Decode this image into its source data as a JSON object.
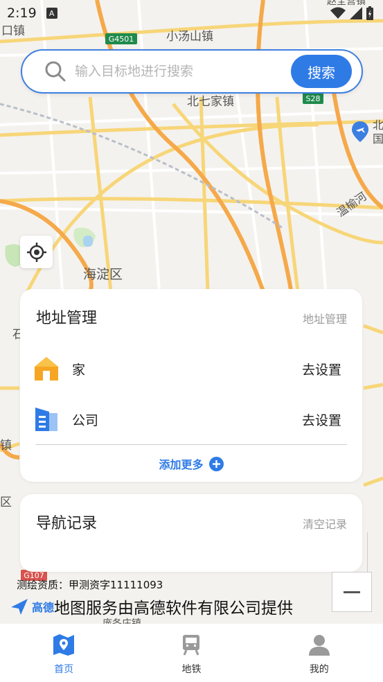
{
  "status_bar": {
    "time": "2:19",
    "notification_icon": "A"
  },
  "map": {
    "labels": {
      "t1": "口镇",
      "t2": "小汤山镇",
      "t3": "北七家镇",
      "t4": "海淀区",
      "t5": "温榆河",
      "t6": "北",
      "t7": "国",
      "t8": "石",
      "t9": "镇",
      "t10": "区",
      "t11": "庞各庄镇",
      "t12": "赵全营镇"
    },
    "road_badges": {
      "b1": "G4501",
      "b2": "S28",
      "b3": "G107"
    }
  },
  "search": {
    "placeholder": "输入目标地进行搜索",
    "button_label": "搜索"
  },
  "address_card": {
    "title": "地址管理",
    "link": "地址管理",
    "items": [
      {
        "label": "家",
        "action": "去设置",
        "icon": "home-icon"
      },
      {
        "label": "公司",
        "action": "去设置",
        "icon": "office-building-icon"
      }
    ],
    "add_more": "添加更多"
  },
  "nav_card": {
    "title": "导航记录",
    "clear": "清空记录"
  },
  "map_footer": {
    "survey": "测绘资质：甲测资字11111093",
    "provider": "地图服务由高德软件有限公司提供",
    "logo_text": "高德"
  },
  "tabs": [
    {
      "label": "首页",
      "icon": "map-icon",
      "active": true
    },
    {
      "label": "地铁",
      "icon": "subway-icon",
      "active": false
    },
    {
      "label": "我的",
      "icon": "user-icon",
      "active": false
    }
  ],
  "colors": {
    "accent": "#2f7be6",
    "home": "#f6a623",
    "office": "#2f7be6"
  }
}
